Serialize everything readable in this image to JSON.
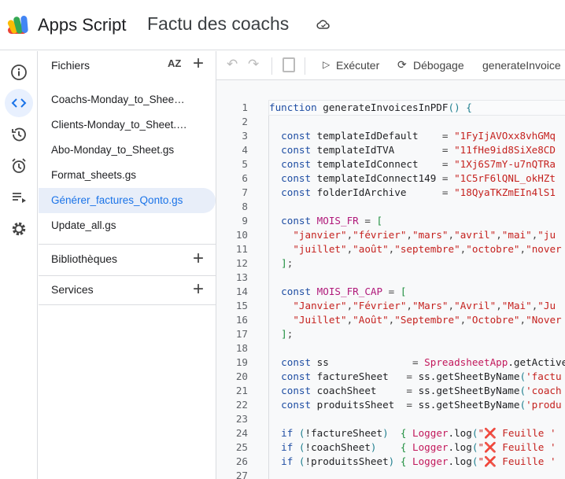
{
  "header": {
    "app_name": "Apps Script",
    "project_title": "Factu des coachs"
  },
  "files_panel": {
    "title": "Fichiers",
    "sort_label": "AZ",
    "files": [
      {
        "name": "Coachs-Monday_to_Sheet.gs",
        "display": "Coachs-Monday_to_Sheet...."
      },
      {
        "name": "Clients-Monday_to_Sheet.gs",
        "display": "Clients-Monday_to_Sheet.gs"
      },
      {
        "name": "Abo-Monday_to_Sheet.gs",
        "display": "Abo-Monday_to_Sheet.gs"
      },
      {
        "name": "Format_sheets.gs",
        "display": "Format_sheets.gs"
      },
      {
        "name": "Générer_factures_Qonto.gs",
        "display": "Générer_factures_Qonto.gs",
        "selected": true
      },
      {
        "name": "Update_all.gs",
        "display": "Update_all.gs"
      }
    ],
    "sections": [
      "Bibliothèques",
      "Services"
    ]
  },
  "toolbar": {
    "run": "Exécuter",
    "debug": "Débogage",
    "function": "generateInvoice"
  },
  "code": [
    {
      "n": "1",
      "t": [
        [
          "kw",
          "function "
        ],
        [
          "id",
          "generateInvoicesInPDF"
        ],
        [
          "par",
          "() "
        ],
        [
          "par",
          "{"
        ]
      ]
    },
    {
      "n": "2",
      "t": []
    },
    {
      "n": "3",
      "t": [
        [
          "kw",
          "  const "
        ],
        [
          "id",
          "templateIdDefault    "
        ],
        [
          "pun",
          "= "
        ],
        [
          "str",
          "\"1FyIjAVOxx8vhGMq"
        ]
      ]
    },
    {
      "n": "4",
      "t": [
        [
          "kw",
          "  const "
        ],
        [
          "id",
          "templateIdTVA        "
        ],
        [
          "pun",
          "= "
        ],
        [
          "str",
          "\"11fHe9id8SiXe8CD"
        ]
      ]
    },
    {
      "n": "5",
      "t": [
        [
          "kw",
          "  const "
        ],
        [
          "id",
          "templateIdConnect    "
        ],
        [
          "pun",
          "= "
        ],
        [
          "str",
          "\"1Xj6S7mY-u7nQTRa"
        ]
      ]
    },
    {
      "n": "6",
      "t": [
        [
          "kw",
          "  const "
        ],
        [
          "id",
          "templateIdConnect149 "
        ],
        [
          "pun",
          "= "
        ],
        [
          "str",
          "\"1C5rF6lQNL_okHZt"
        ]
      ]
    },
    {
      "n": "7",
      "t": [
        [
          "kw",
          "  const "
        ],
        [
          "id",
          "folderIdArchive      "
        ],
        [
          "pun",
          "= "
        ],
        [
          "str",
          "\"18QyaTKZmEIn4lS1"
        ]
      ]
    },
    {
      "n": "8",
      "t": []
    },
    {
      "n": "9",
      "t": [
        [
          "kw",
          "  const "
        ],
        [
          "cst",
          "MOIS_FR "
        ],
        [
          "pun",
          "= "
        ],
        [
          "br",
          "["
        ]
      ]
    },
    {
      "n": "10",
      "t": [
        [
          "str",
          "    \"janvier\""
        ],
        [
          "pun",
          ","
        ],
        [
          "str",
          "\"février\""
        ],
        [
          "pun",
          ","
        ],
        [
          "str",
          "\"mars\""
        ],
        [
          "pun",
          ","
        ],
        [
          "str",
          "\"avril\""
        ],
        [
          "pun",
          ","
        ],
        [
          "str",
          "\"mai\""
        ],
        [
          "pun",
          ","
        ],
        [
          "str",
          "\"ju"
        ]
      ]
    },
    {
      "n": "11",
      "t": [
        [
          "str",
          "    \"juillet\""
        ],
        [
          "pun",
          ","
        ],
        [
          "str",
          "\"août\""
        ],
        [
          "pun",
          ","
        ],
        [
          "str",
          "\"septembre\""
        ],
        [
          "pun",
          ","
        ],
        [
          "str",
          "\"octobre\""
        ],
        [
          "pun",
          ","
        ],
        [
          "str",
          "\"nover"
        ]
      ]
    },
    {
      "n": "12",
      "t": [
        [
          "br",
          "  ]"
        ],
        [
          "pun",
          ";"
        ]
      ]
    },
    {
      "n": "13",
      "t": []
    },
    {
      "n": "14",
      "t": [
        [
          "kw",
          "  const "
        ],
        [
          "cst",
          "MOIS_FR_CAP "
        ],
        [
          "pun",
          "= "
        ],
        [
          "br",
          "["
        ]
      ]
    },
    {
      "n": "15",
      "t": [
        [
          "str",
          "    \"Janvier\""
        ],
        [
          "pun",
          ","
        ],
        [
          "str",
          "\"Février\""
        ],
        [
          "pun",
          ","
        ],
        [
          "str",
          "\"Mars\""
        ],
        [
          "pun",
          ","
        ],
        [
          "str",
          "\"Avril\""
        ],
        [
          "pun",
          ","
        ],
        [
          "str",
          "\"Mai\""
        ],
        [
          "pun",
          ","
        ],
        [
          "str",
          "\"Ju"
        ]
      ]
    },
    {
      "n": "16",
      "t": [
        [
          "str",
          "    \"Juillet\""
        ],
        [
          "pun",
          ","
        ],
        [
          "str",
          "\"Août\""
        ],
        [
          "pun",
          ","
        ],
        [
          "str",
          "\"Septembre\""
        ],
        [
          "pun",
          ","
        ],
        [
          "str",
          "\"Octobre\""
        ],
        [
          "pun",
          ","
        ],
        [
          "str",
          "\"Nover"
        ]
      ]
    },
    {
      "n": "17",
      "t": [
        [
          "br",
          "  ]"
        ],
        [
          "pun",
          ";"
        ]
      ]
    },
    {
      "n": "18",
      "t": []
    },
    {
      "n": "19",
      "t": [
        [
          "kw",
          "  const "
        ],
        [
          "id",
          "ss              "
        ],
        [
          "pun",
          "= "
        ],
        [
          "cls",
          "SpreadsheetApp"
        ],
        [
          "id",
          ".getActive"
        ]
      ]
    },
    {
      "n": "20",
      "t": [
        [
          "kw",
          "  const "
        ],
        [
          "id",
          "factureSheet   "
        ],
        [
          "pun",
          "= "
        ],
        [
          "id",
          "ss.getSheetByName"
        ],
        [
          "par",
          "("
        ],
        [
          "str",
          "'factu"
        ]
      ]
    },
    {
      "n": "21",
      "t": [
        [
          "kw",
          "  const "
        ],
        [
          "id",
          "coachSheet     "
        ],
        [
          "pun",
          "= "
        ],
        [
          "id",
          "ss.getSheetByName"
        ],
        [
          "par",
          "("
        ],
        [
          "str",
          "'coach"
        ]
      ]
    },
    {
      "n": "22",
      "t": [
        [
          "kw",
          "  const "
        ],
        [
          "id",
          "produitsSheet  "
        ],
        [
          "pun",
          "= "
        ],
        [
          "id",
          "ss.getSheetByName"
        ],
        [
          "par",
          "("
        ],
        [
          "str",
          "'produ"
        ]
      ]
    },
    {
      "n": "23",
      "t": []
    },
    {
      "n": "24",
      "t": [
        [
          "kw",
          "  if "
        ],
        [
          "par",
          "("
        ],
        [
          "id",
          "!factureSheet"
        ],
        [
          "par",
          ")  "
        ],
        [
          "br",
          "{ "
        ],
        [
          "cls",
          "Logger"
        ],
        [
          "id",
          ".log"
        ],
        [
          "par",
          "("
        ],
        [
          "str",
          "\"❌ Feuille '"
        ]
      ]
    },
    {
      "n": "25",
      "t": [
        [
          "kw",
          "  if "
        ],
        [
          "par",
          "("
        ],
        [
          "id",
          "!coachSheet"
        ],
        [
          "par",
          ")    "
        ],
        [
          "br",
          "{ "
        ],
        [
          "cls",
          "Logger"
        ],
        [
          "id",
          ".log"
        ],
        [
          "par",
          "("
        ],
        [
          "str",
          "\"❌ Feuille '"
        ]
      ]
    },
    {
      "n": "26",
      "t": [
        [
          "kw",
          "  if "
        ],
        [
          "par",
          "("
        ],
        [
          "id",
          "!produitsSheet"
        ],
        [
          "par",
          ") "
        ],
        [
          "br",
          "{ "
        ],
        [
          "cls",
          "Logger"
        ],
        [
          "id",
          ".log"
        ],
        [
          "par",
          "("
        ],
        [
          "str",
          "\"❌ Feuille '"
        ]
      ]
    },
    {
      "n": "27",
      "t": []
    }
  ]
}
